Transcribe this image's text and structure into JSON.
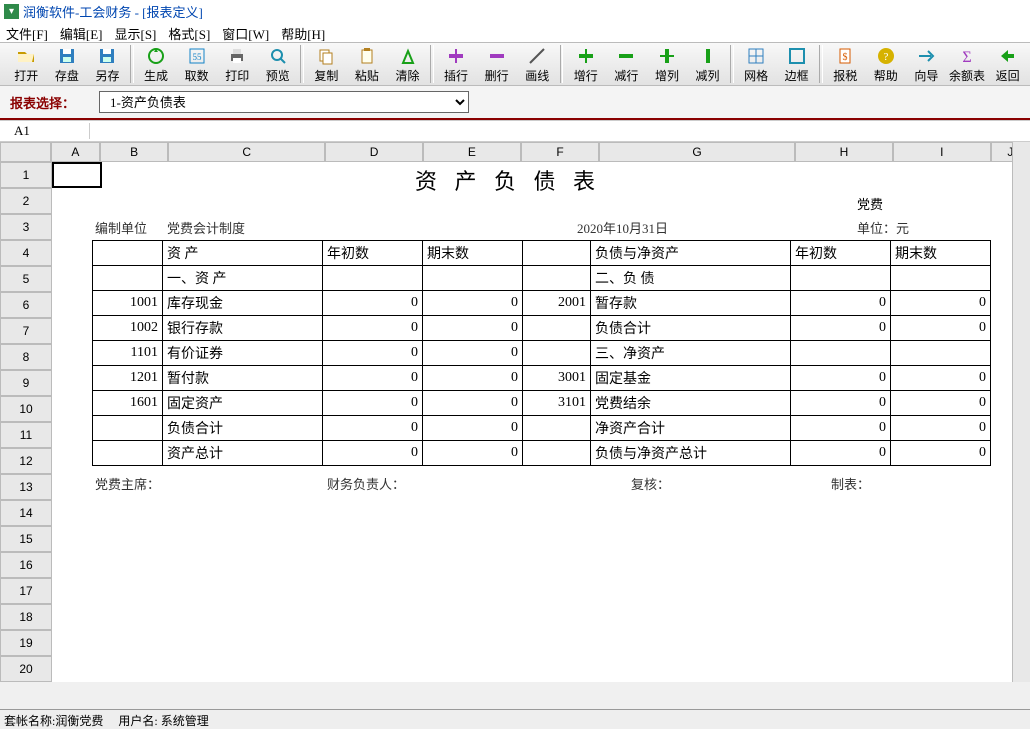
{
  "app": {
    "title": "润衡软件-工会财务 - [报表定义]"
  },
  "menubar": [
    "文件[F]",
    "编辑[E]",
    "显示[S]",
    "格式[S]",
    "窗口[W]",
    "帮助[H]"
  ],
  "toolbar": [
    {
      "icon": "open",
      "label": "打开",
      "color": "#c79b00"
    },
    {
      "icon": "disk",
      "label": "存盘",
      "color": "#2f7fbf"
    },
    {
      "icon": "saveas",
      "label": "另存",
      "color": "#2f7fbf"
    },
    {
      "icon": "gen",
      "label": "生成",
      "color": "#18a018"
    },
    {
      "icon": "num",
      "label": "取数",
      "color": "#1383c7"
    },
    {
      "icon": "print",
      "label": "打印",
      "color": "#666"
    },
    {
      "icon": "preview",
      "label": "预览",
      "color": "#1d8fae"
    },
    {
      "icon": "copy",
      "label": "复制",
      "color": "#b37f1f"
    },
    {
      "icon": "paste",
      "label": "粘贴",
      "color": "#b37f1f"
    },
    {
      "icon": "clear",
      "label": "清除",
      "color": "#18a018"
    },
    {
      "icon": "insrow",
      "label": "插行",
      "color": "#a03bbf"
    },
    {
      "icon": "delrow",
      "label": "删行",
      "color": "#a03bbf"
    },
    {
      "icon": "line",
      "label": "画线",
      "color": "#555"
    },
    {
      "icon": "addrow",
      "label": "增行",
      "color": "#18a018"
    },
    {
      "icon": "minrow",
      "label": "减行",
      "color": "#18a018"
    },
    {
      "icon": "addcol",
      "label": "增列",
      "color": "#18a018"
    },
    {
      "icon": "mincol",
      "label": "减列",
      "color": "#18a018"
    },
    {
      "icon": "grid",
      "label": "网格",
      "color": "#2f7fbf"
    },
    {
      "icon": "border",
      "label": "边框",
      "color": "#1d8fae"
    },
    {
      "icon": "tax",
      "label": "报税",
      "color": "#d65a00"
    },
    {
      "icon": "help",
      "label": "帮助",
      "color": "#d6b200"
    },
    {
      "icon": "guide",
      "label": "向导",
      "color": "#1d8fae"
    },
    {
      "icon": "sum",
      "label": "余额表",
      "color": "#a03bbf"
    },
    {
      "icon": "back",
      "label": "返回",
      "color": "#18a018"
    }
  ],
  "selector": {
    "label": "报表选择：",
    "current": "1-资产负债表"
  },
  "cellref": "A1",
  "columns": [
    "A",
    "B",
    "C",
    "D",
    "E",
    "F",
    "G",
    "H",
    "I",
    "J"
  ],
  "rowcount": 21,
  "sheet": {
    "title": "资 产 负 债 表",
    "tagline": "党费",
    "org_label": "编制单位",
    "org_value": "党费会计制度",
    "date": "2020年10月31日",
    "unit": "单位：元",
    "headers": {
      "c1": "资    产",
      "c2": "年初数",
      "c3": "期末数",
      "c4": "负债与净资产",
      "c5": "年初数",
      "c6": "期末数"
    },
    "rows": [
      {
        "ln": "",
        "name": "一、资 产",
        "v1": "",
        "v2": "",
        "rn": "",
        "rname": "二、负 债",
        "rv1": "",
        "rv2": ""
      },
      {
        "ln": "1001",
        "name": "库存现金",
        "v1": "0",
        "v2": "0",
        "rn": "2001",
        "rname": "暂存款",
        "rv1": "0",
        "rv2": "0"
      },
      {
        "ln": "1002",
        "name": "银行存款",
        "v1": "0",
        "v2": "0",
        "rn": "",
        "rname": "负债合计",
        "rv1": "0",
        "rv2": "0"
      },
      {
        "ln": "1101",
        "name": "有价证券",
        "v1": "0",
        "v2": "0",
        "rn": "",
        "rname": "三、净资产",
        "rv1": "",
        "rv2": ""
      },
      {
        "ln": "1201",
        "name": "暂付款",
        "v1": "0",
        "v2": "0",
        "rn": "3001",
        "rname": "固定基金",
        "rv1": "0",
        "rv2": "0"
      },
      {
        "ln": "1601",
        "name": "固定资产",
        "v1": "0",
        "v2": "0",
        "rn": "3101",
        "rname": "党费结余",
        "rv1": "0",
        "rv2": "0"
      },
      {
        "ln": "",
        "name": "负债合计",
        "v1": "0",
        "v2": "0",
        "rn": "",
        "rname": "净资产合计",
        "rv1": "0",
        "rv2": "0"
      },
      {
        "ln": "",
        "name": "资产总计",
        "v1": "0",
        "v2": "0",
        "rn": "",
        "rname": "负债与净资产总计",
        "rv1": "0",
        "rv2": "0"
      }
    ],
    "footer": {
      "a": "党费主席：",
      "b": "财务负责人：",
      "c": "复核：",
      "d": "制表："
    }
  },
  "status": {
    "acct_label": "套帐名称:",
    "acct": "润衡党费",
    "user_label": "用户名:",
    "user": "系统管理"
  }
}
